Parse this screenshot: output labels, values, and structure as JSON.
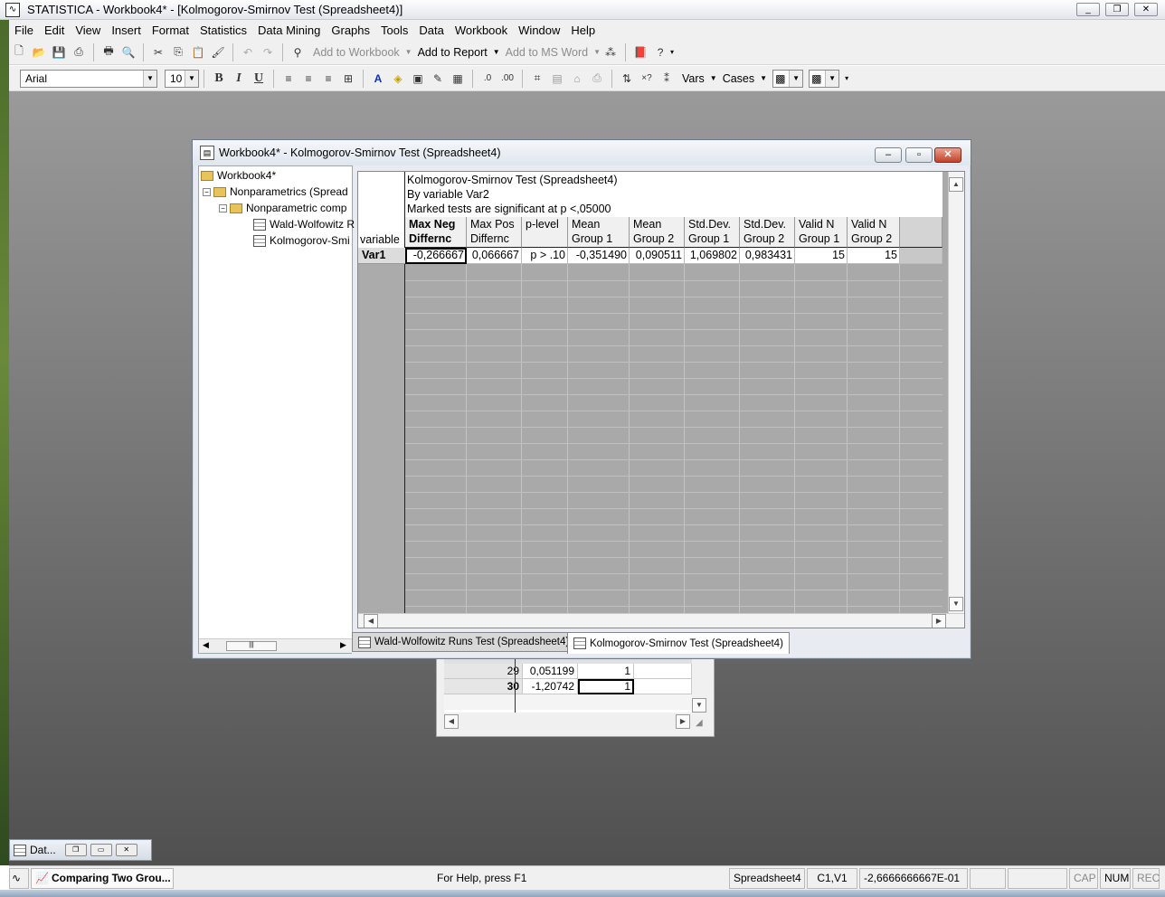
{
  "app": {
    "title": "STATISTICA - Workbook4* - [Kolmogorov-Smirnov Test (Spreadsheet4)]",
    "icon": "statistica-icon"
  },
  "menu": [
    "File",
    "Edit",
    "View",
    "Insert",
    "Format",
    "Statistics",
    "Data Mining",
    "Graphs",
    "Tools",
    "Data",
    "Workbook",
    "Window",
    "Help"
  ],
  "toolbar1": {
    "add_to_workbook": "Add to Workbook",
    "add_to_report": "Add to Report",
    "add_to_ms_word": "Add to MS Word"
  },
  "toolbar2": {
    "font_name": "Arial",
    "font_size": "10",
    "bold": "B",
    "italic": "I",
    "underline": "U",
    "vars": "Vars",
    "cases": "Cases"
  },
  "workbook": {
    "title": "Workbook4* - Kolmogorov-Smirnov Test (Spreadsheet4)",
    "tree": {
      "root": "Workbook4*",
      "node1": "Nonparametrics (Spread",
      "node2": "Nonparametric comp",
      "leaf1": "Wald-Wolfowitz R",
      "leaf2": "Kolmogorov-Smi"
    },
    "sheet": {
      "header_lines": [
        "Kolmogorov-Smirnov Test (Spreadsheet4)",
        "By variable Var2",
        "Marked tests are significant at p <,05000"
      ],
      "rowhead_label": "variable",
      "columns": [
        {
          "l1": "Max Neg",
          "l2": "Differnc"
        },
        {
          "l1": "Max Pos",
          "l2": "Differnc"
        },
        {
          "l1": "p-level",
          "l2": ""
        },
        {
          "l1": "Mean",
          "l2": "Group 1"
        },
        {
          "l1": "Mean",
          "l2": "Group 2"
        },
        {
          "l1": "Std.Dev.",
          "l2": "Group 1"
        },
        {
          "l1": "Std.Dev.",
          "l2": "Group 2"
        },
        {
          "l1": "Valid N",
          "l2": "Group 1"
        },
        {
          "l1": "Valid N",
          "l2": "Group 2"
        }
      ],
      "row_label": "Var1",
      "values": [
        "-0,266667",
        "0,066667",
        "p > .10",
        "-0,351490",
        "0,090511",
        "1,069802",
        "0,983431",
        "15",
        "15"
      ]
    },
    "tabs": [
      "Wald-Wolfowitz Runs Test (Spreadsheet4)",
      "Kolmogorov-Smirnov Test (Spreadsheet4)"
    ]
  },
  "background_sheet": {
    "rows": [
      {
        "n": "29",
        "v": "0,051199",
        "g": "1"
      },
      {
        "n": "30",
        "v": "-1,20742",
        "g": "1"
      }
    ]
  },
  "minimized": {
    "label": "Dat..."
  },
  "status": {
    "taskbar_item": "Comparing Two Grou...",
    "help": "For Help, press F1",
    "sheet": "Spreadsheet4",
    "cell": "C1,V1",
    "value": "-2,6666666667E-01",
    "cap": "CAP",
    "num": "NUM",
    "rec": "REC"
  }
}
